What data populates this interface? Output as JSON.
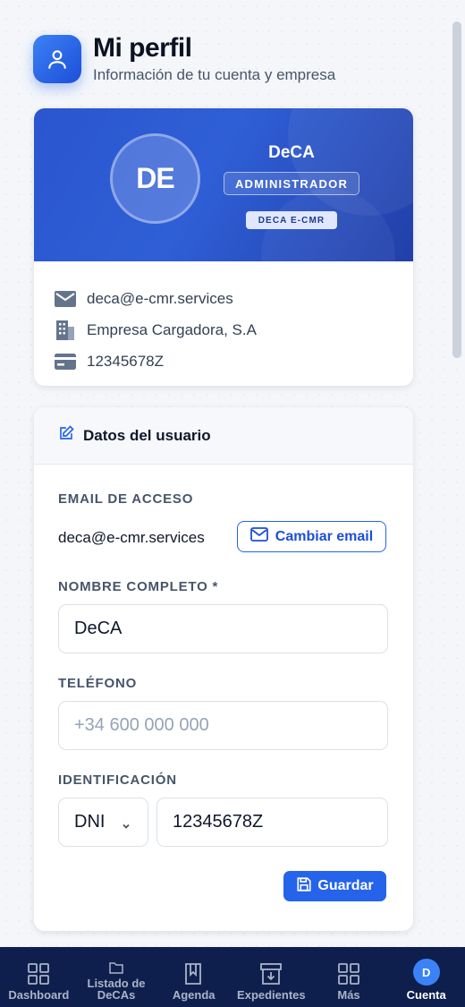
{
  "header": {
    "title": "Mi perfil",
    "subtitle": "Información de tu cuenta y empresa",
    "icon": "user-icon"
  },
  "profile": {
    "initials": "DE",
    "name": "DeCA",
    "role": "ADMINISTRADOR",
    "company_badge": "DECA E-CMR",
    "email": "deca@e-cmr.services",
    "company": "Empresa Cargadora, S.A",
    "id_number": "12345678Z"
  },
  "form": {
    "title": "Datos del usuario",
    "email_label": "EMAIL DE ACCESO",
    "email_value": "deca@e-cmr.services",
    "change_email_label": "Cambiar email",
    "name_label": "NOMBRE COMPLETO *",
    "name_value": "DeCA",
    "phone_label": "TELÉFONO",
    "phone_placeholder": "+34 600 000 000",
    "id_label": "IDENTIFICACIÓN",
    "id_type": "DNI",
    "id_value": "12345678Z",
    "save_label": "Guardar"
  },
  "nav": {
    "items": [
      {
        "label": "Dashboard",
        "icon": "grid-icon"
      },
      {
        "label": "Listado de DeCAs",
        "icon": "folder-icon"
      },
      {
        "label": "Agenda",
        "icon": "book-icon"
      },
      {
        "label": "Expedientes",
        "icon": "archive-icon"
      },
      {
        "label": "Más",
        "icon": "grid-icon"
      },
      {
        "label": "Cuenta",
        "icon": "avatar",
        "avatar_initial": "D",
        "active": true
      }
    ]
  },
  "colors": {
    "primary": "#2563eb",
    "nav_bg": "#0f1f4d",
    "banner": "#2a56cf"
  }
}
